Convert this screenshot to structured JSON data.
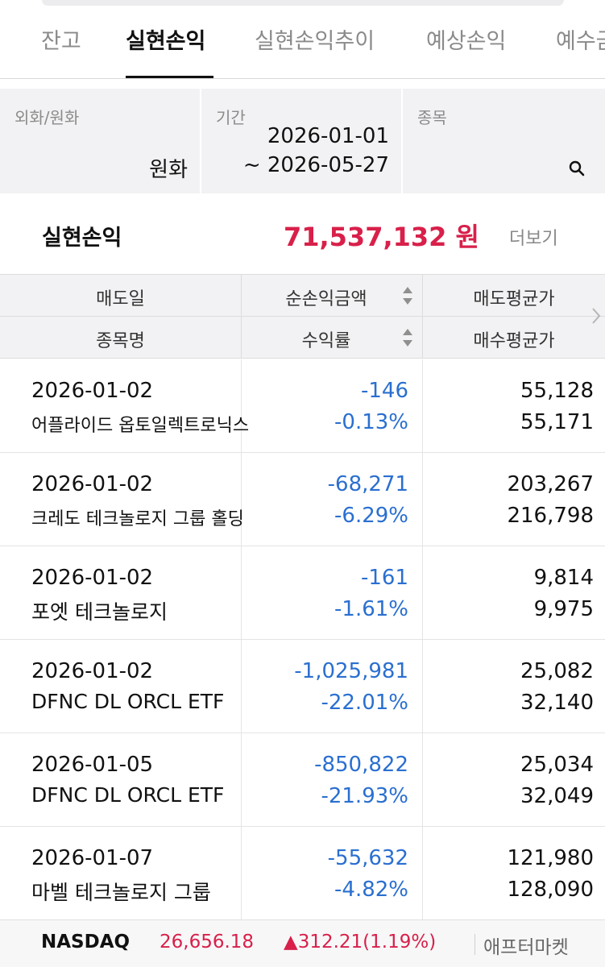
{
  "tabs": [
    {
      "label": "잔고"
    },
    {
      "label": "실현손익"
    },
    {
      "label": "실현손익추이"
    },
    {
      "label": "예상손익"
    },
    {
      "label": "예수금"
    }
  ],
  "filters": {
    "currency": {
      "label": "외화/원화",
      "value": "원화"
    },
    "period": {
      "label": "기간",
      "start": "2026-01-01",
      "end": "~ 2026-05-27"
    },
    "stock": {
      "label": "종목"
    }
  },
  "summary": {
    "label": "실현손익",
    "amount": "71,537,132 원",
    "more": "더보기"
  },
  "table": {
    "headers": {
      "sell_date": "매도일",
      "net_pl": "순손익금액",
      "sell_avg": "매도평균가",
      "stock_name": "종목명",
      "return_rate": "수익률",
      "buy_avg": "매수평균가"
    },
    "rows": [
      {
        "date": "2026-01-02",
        "name": "어플라이드 옵토일렉트로닉스",
        "pl": "-146",
        "rate": "-0.13%",
        "sell": "55,128",
        "buy": "55,171"
      },
      {
        "date": "2026-01-02",
        "name": "크레도 테크놀로지 그룹 홀딩",
        "pl": "-68,271",
        "rate": "-6.29%",
        "sell": "203,267",
        "buy": "216,798"
      },
      {
        "date": "2026-01-02",
        "name": "포엣 테크놀로지",
        "pl": "-161",
        "rate": "-1.61%",
        "sell": "9,814",
        "buy": "9,975"
      },
      {
        "date": "2026-01-02",
        "name": "DFNC DL ORCL ETF",
        "pl": "-1,025,981",
        "rate": "-22.01%",
        "sell": "25,082",
        "buy": "32,140"
      },
      {
        "date": "2026-01-05",
        "name": "DFNC DL ORCL ETF",
        "pl": "-850,822",
        "rate": "-21.93%",
        "sell": "25,034",
        "buy": "32,049"
      },
      {
        "date": "2026-01-07",
        "name": "마벨 테크놀로지 그룹",
        "pl": "-55,632",
        "rate": "-4.82%",
        "sell": "121,980",
        "buy": "128,090"
      }
    ]
  },
  "ticker": {
    "name": "NASDAQ",
    "value": "26,656.18",
    "change": "▲312.21(1.19%)",
    "session": "애프터마켓"
  },
  "colors": {
    "accent_red": "#d8204a",
    "loss_blue": "#2a6fd0",
    "header_bg": "#f2f2f4"
  },
  "icons": {
    "search": "search-icon",
    "sort": "sort-icon",
    "scroll_right": "chevron-right-icon"
  }
}
